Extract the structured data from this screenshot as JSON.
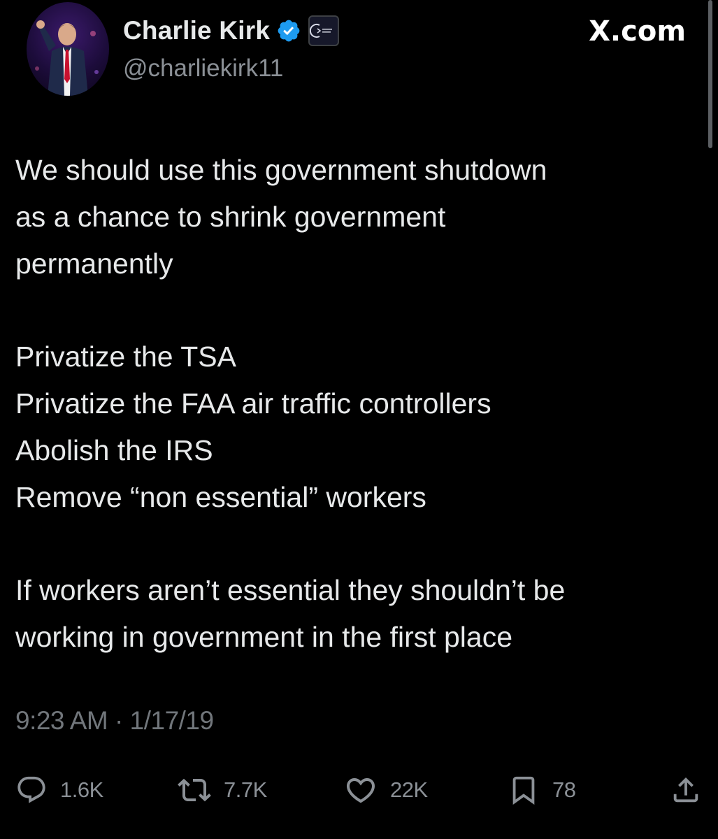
{
  "author": {
    "display_name": "Charlie Kirk",
    "handle": "@charliekirk11",
    "verified_badge_color": "#1d9bf0",
    "verified_icon": "verified-check-icon",
    "affiliate_badge_icon": "turning-point-usa-logo-icon"
  },
  "site": {
    "logo_text": "X.com"
  },
  "tweet": {
    "paragraphs": [
      {
        "lines": [
          "We should use this government shutdown",
          "as a chance to shrink government",
          "permanently"
        ]
      },
      {
        "lines": [
          "Privatize the TSA",
          "Privatize the FAA air traffic controllers",
          "Abolish the IRS",
          "Remove “non essential” workers"
        ]
      },
      {
        "lines": [
          "If workers aren’t essential they shouldn’t be",
          "working in government in the first place"
        ]
      }
    ],
    "timestamp": "9:23 AM · 1/17/19"
  },
  "actions": {
    "reply": {
      "icon": "reply-icon",
      "count": "1.6K"
    },
    "repost": {
      "icon": "repost-icon",
      "count": "7.7K"
    },
    "like": {
      "icon": "heart-icon",
      "count": "22K"
    },
    "bookmark": {
      "icon": "bookmark-icon",
      "count": "78"
    },
    "share": {
      "icon": "share-icon"
    }
  },
  "colors": {
    "background": "#000000",
    "primary_text": "#e7e9ea",
    "secondary_text": "#71767b",
    "accent_blue": "#1d9bf0"
  }
}
